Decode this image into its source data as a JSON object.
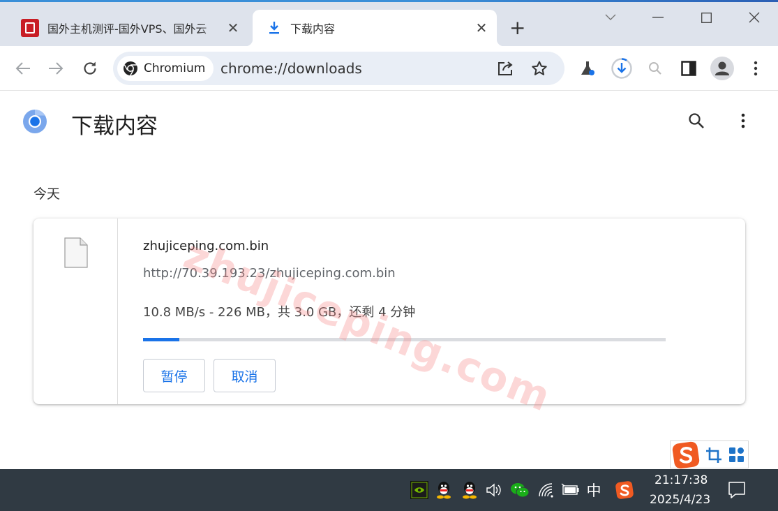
{
  "browser": {
    "tabs": [
      {
        "title": "国外主机测评-国外VPS、国外云",
        "active": false,
        "close_label": "✕"
      },
      {
        "title": "下载内容",
        "active": true,
        "close_label": "✕"
      }
    ],
    "new_tab_label": "+",
    "omnibox": {
      "chip_label": "Chromium",
      "url": "chrome://downloads"
    }
  },
  "page": {
    "title": "下载内容",
    "watermark": "zhujiceping.com"
  },
  "downloads": {
    "section_date": "今天",
    "items": [
      {
        "file_name": "zhujiceping.com.bin",
        "url": "http://70.39.193.23/zhujiceping.com.bin",
        "status": "10.8 MB/s - 226 MB，共 3.0 GB，还剩 4 分钟",
        "progress_percent": 7,
        "pause_label": "暂停",
        "cancel_label": "取消"
      }
    ]
  },
  "taskbar": {
    "ime_label": "中",
    "time": "21:17:38",
    "date": "2025/4/23"
  },
  "colors": {
    "accent": "#1a73e8",
    "tabstrip": "#dee3ec",
    "omnibox": "#e9eef6",
    "taskbar": "#303a43",
    "watermark": "#f58c8c"
  }
}
